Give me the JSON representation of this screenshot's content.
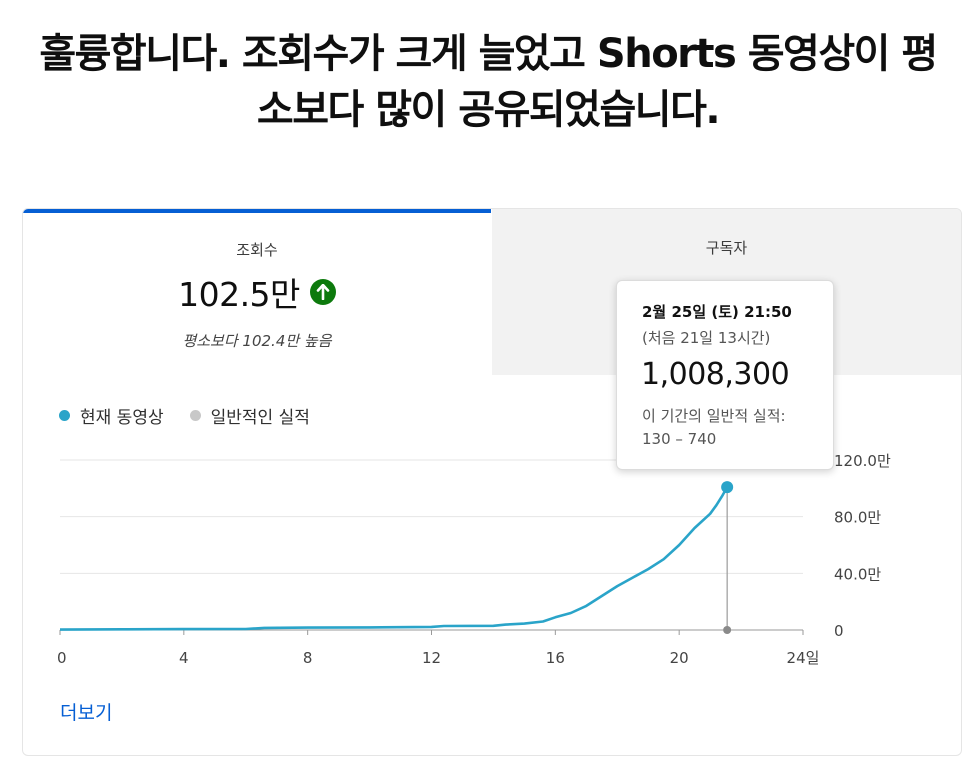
{
  "headline": {
    "line1": "훌륭합니다. 조회수가 크게 늘었고 Shorts 동영상이 평",
    "line2": "소보다 많이 공유되었습니다."
  },
  "tabs": [
    {
      "label": "조회수",
      "value": "102.5만",
      "comparison": "평소보다 102.4만 높음",
      "trend": "up-arrow-icon",
      "selected": true
    },
    {
      "label": "구독자",
      "value": "",
      "selected": false
    }
  ],
  "legend": {
    "current": "현재 동영상",
    "typical": "일반적인 실적"
  },
  "tooltip": {
    "date": "2월 25일 (토) 21:50",
    "elapsed": "(처음 21일 13시간)",
    "value": "1,008,300",
    "typical_label": "이 기간의 일반적 실적:",
    "typical_range": "130 – 740"
  },
  "more_link": "더보기",
  "colors": {
    "accent": "#065fd4",
    "series_current": "#2aa4c9",
    "series_typical": "#c8c8c8",
    "trend_up": "#0d7a0d"
  },
  "chart_data": {
    "type": "line",
    "xlabel": "",
    "ylabel": "",
    "x_ticks": [
      "0",
      "4",
      "8",
      "12",
      "16",
      "20",
      "24일"
    ],
    "x_tick_values": [
      0,
      4,
      8,
      12,
      16,
      20,
      24
    ],
    "y_ticks": [
      "0",
      "40.0만",
      "80.0만",
      "120.0만"
    ],
    "y_tick_values": [
      0,
      400000,
      800000,
      1200000
    ],
    "xlim": [
      0,
      24
    ],
    "ylim": [
      0,
      1200000
    ],
    "grid": true,
    "series": [
      {
        "name": "현재 동영상",
        "x": [
          0,
          2,
          4,
          6,
          6.6,
          8,
          10,
          12,
          12.4,
          14,
          14.4,
          15,
          15.6,
          16,
          16.5,
          17,
          17.5,
          18,
          18.5,
          19,
          19.5,
          20,
          20.5,
          21,
          21.2,
          21.4,
          21.55
        ],
        "y": [
          3000,
          5000,
          6000,
          7000,
          15000,
          17000,
          18000,
          22000,
          28000,
          30000,
          38000,
          45000,
          60000,
          90000,
          120000,
          170000,
          240000,
          310000,
          370000,
          430000,
          500000,
          600000,
          720000,
          820000,
          880000,
          950000,
          1008300
        ]
      },
      {
        "name": "일반적인 실적",
        "x": [
          21.55
        ],
        "y": [
          0
        ]
      }
    ],
    "hover_x": 21.55
  }
}
